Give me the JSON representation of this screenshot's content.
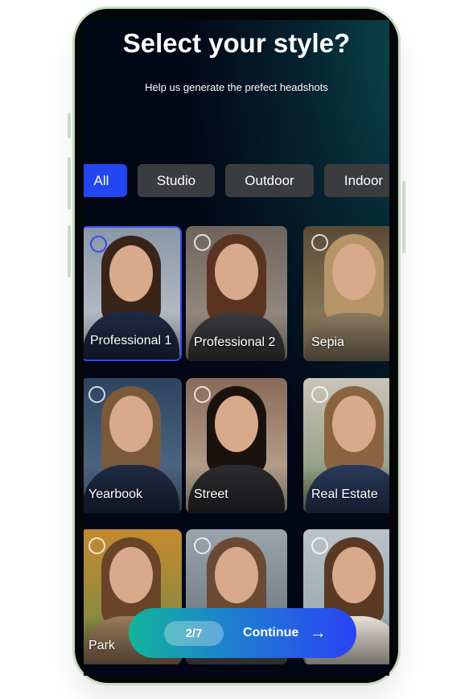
{
  "header": {
    "title": "Select your style?",
    "subtitle": "Help us generate the prefect headshots"
  },
  "tabs": [
    {
      "label": "All",
      "active": true
    },
    {
      "label": "Studio"
    },
    {
      "label": "Outdoor"
    },
    {
      "label": "Indoor"
    }
  ],
  "styles": [
    {
      "label": "Professional 1",
      "selected": true
    },
    {
      "label": "Professional 2"
    },
    {
      "label": "Sepia"
    },
    {
      "label": "Yearbook"
    },
    {
      "label": "Street"
    },
    {
      "label": "Real Estate"
    },
    {
      "label": "Park"
    },
    {
      "label": ""
    },
    {
      "label": ""
    }
  ],
  "footer": {
    "progress": "2/7",
    "continue_label": "Continue",
    "arrow_icon": "arrow-right-icon"
  },
  "colors": {
    "accent": "#2446f2",
    "background": "#020716",
    "gradient_start": "#12b59a",
    "gradient_end": "#2a43f5"
  }
}
